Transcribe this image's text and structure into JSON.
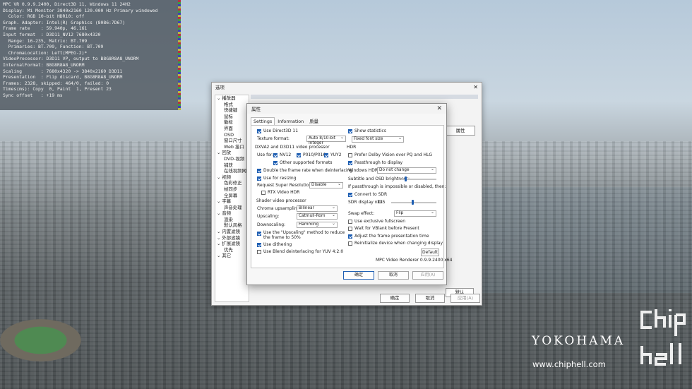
{
  "osd": {
    "lines": [
      "MPC VR 0.9.9.2400, Direct3D 11, Windows 11 24H2",
      "Display: Mi Monitor 3840x2160 120.000 Hz Primary windowed",
      "  Color: RGB 10-bit HDR10: off",
      "Graph. Adapter: Intel(R) Graphics (8086:7D67)",
      "Frame rate    : 59.940p, 46.161",
      "Input format  : D3D11_NV12 7680x4320",
      "  Range: 16-235, Matrix: BT.709",
      "  Primaries: BT.709, Function: BT.709",
      "  ChromaLocation: Left(MPEG-2)*",
      "VideoProcessor: D3D11 VP, output to B8G8R8A8_UNORM",
      "InternalFormat: B8G8R8A8_UNORM",
      "Scaling       : 7680x4320 -> 3840x2160 D3D11",
      "Presentation  : Flip discard, B8G8R8A8_UNORM",
      "Frames: 2328, skipped: 464/0, failed: 0",
      "Times(ms): Copy  0, Paint  1, Present 23",
      "Sync offset   : +19 ms"
    ]
  },
  "options_dialog": {
    "title": "选项",
    "tree": [
      {
        "label": "播放器",
        "level": 0
      },
      {
        "label": "格式",
        "level": 1
      },
      {
        "label": "快捷键",
        "level": 1
      },
      {
        "label": "鼠标",
        "level": 1
      },
      {
        "label": "徽标",
        "level": 1
      },
      {
        "label": "界面",
        "level": 1
      },
      {
        "label": "OSD",
        "level": 1
      },
      {
        "label": "窗口尺寸",
        "level": 1
      },
      {
        "label": "Web 接口",
        "level": 1
      },
      {
        "label": "回放",
        "level": 0
      },
      {
        "label": "DVD-视频",
        "level": 1
      },
      {
        "label": "捕获",
        "level": 1
      },
      {
        "label": "在线视频网址",
        "level": 1
      },
      {
        "label": "视频",
        "level": 0
      },
      {
        "label": "色彩修正",
        "level": 1
      },
      {
        "label": "帧同步",
        "level": 1
      },
      {
        "label": "全屏幕",
        "level": 1
      },
      {
        "label": "字幕",
        "level": 0
      },
      {
        "label": "声音处理",
        "level": 1
      },
      {
        "label": "音频",
        "level": 0
      },
      {
        "label": "渲染",
        "level": 1
      },
      {
        "label": "默认风格",
        "level": 1
      },
      {
        "label": "内置滤镜",
        "level": 0
      },
      {
        "label": "外部滤镜",
        "level": 0
      },
      {
        "label": "扩展滤镜",
        "level": 0
      },
      {
        "label": "优先",
        "level": 1
      },
      {
        "label": "其它",
        "level": 0
      }
    ],
    "properties_button": "属性",
    "default_button": "默认",
    "ok": "确定",
    "cancel": "取消",
    "apply": "应用(A)"
  },
  "properties_dialog": {
    "title": "属性",
    "close_icon": "✕",
    "tabs": [
      "Settings",
      "Information",
      "质量"
    ],
    "left": {
      "use_d3d11": "Use Direct3D 11",
      "texture_format_label": "Texture format:",
      "texture_format_value": "Auto 8/10-bit Integer",
      "dxva_group": "DXVA2 and D3D11 video processor",
      "use_for_label": "Use for:",
      "nv12": "NV12",
      "p010": "P010/P016",
      "yuy2": "YUY2",
      "other_formats": "Other supported formats",
      "double_frame_rate": "Double the frame rate when deinterlacing",
      "use_for_resizing": "Use for resizing",
      "super_res_label": "Request Super Resolution:",
      "super_res_value": "Disable",
      "rtx_hdr": "RTX Video HDR",
      "shader_group": "Shader video processor",
      "chroma_label": "Chroma upsampling:",
      "chroma_value": "Bilinear",
      "upscaling_label": "Upscaling:",
      "upscaling_value": "Catmull-Rom",
      "downscaling_label": "Downscaling:",
      "downscaling_value": "Hamming",
      "use_upscaling_line1": "Use the \"Upscaling\" method to reduce",
      "use_upscaling_line2": "the frame to 50%",
      "use_dithering": "Use dithering",
      "blend_deinterlace": "Use Blend deinterlacing for YUV 4:2:0"
    },
    "right": {
      "show_stats": "Show statistics",
      "font_size_value": "Fixed font size",
      "hdr_group": "HDR",
      "prefer_dolby": "Prefer Dolby Vision over PQ and HLG",
      "passthrough": "Passthrough to display",
      "windows_hdr_label": "Windows HDR:",
      "windows_hdr_value": "Do not change",
      "subtitle_brightness": "Subtitle and OSD brightness:",
      "passthrough_impossible": "If passthrough is impossible or disabled, then:",
      "convert_sdr": "Convert to SDR",
      "sdr_nits_label": "SDR display nits:",
      "sdr_nits_value": "125",
      "swap_effect_label": "Swap effect:",
      "swap_effect_value": "Flip",
      "exclusive_fullscreen": "Use exclusive fullscreen",
      "wait_vblank": "Wait for VBlank before Present",
      "adjust_presentation": "Adjust the frame presentation time",
      "reinitialize": "Reinitialize device when changing display",
      "default_button": "Default",
      "renderer_version": "MPC Video Renderer 0.9.9.2400 x64"
    },
    "ok": "确定",
    "cancel": "取消",
    "apply": "应用(A)"
  },
  "watermark": {
    "city": "YOKOHAMA",
    "site": "www.chiphell.com",
    "logo": "chip hell"
  }
}
